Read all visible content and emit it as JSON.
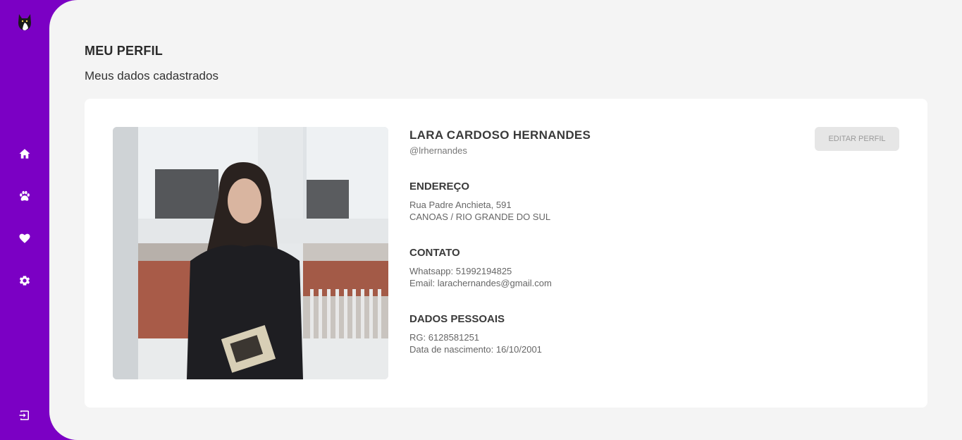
{
  "sidebar": {
    "logo_icon": "cat-icon",
    "nav": [
      {
        "icon": "home-icon"
      },
      {
        "icon": "paw-icon"
      },
      {
        "icon": "heart-icon"
      },
      {
        "icon": "gear-icon"
      }
    ],
    "logout_icon": "logout-icon"
  },
  "header": {
    "title": "MEU PERFIL",
    "subtitle": "Meus dados cadastrados"
  },
  "profile": {
    "name": "LARA CARDOSO HERNANDES",
    "username": "@lrhernandes",
    "edit_button": "EDITAR PERFIL",
    "address": {
      "title": "ENDEREÇO",
      "street": "Rua Padre Anchieta, 591",
      "city_state": "CANOAS / RIO GRANDE DO SUL"
    },
    "contact": {
      "title": "CONTATO",
      "whatsapp": "Whatsapp: 51992194825",
      "email": "Email: larachernandes@gmail.com"
    },
    "personal": {
      "title": "DADOS PESSOAIS",
      "rg": "RG: 6128581251",
      "birth": "Data de nascimento: 16/10/2001"
    }
  },
  "colors": {
    "sidebar": "#7b00c4",
    "background": "#f4f4f4",
    "card": "#ffffff",
    "button_disabled": "#e6e6e6"
  }
}
